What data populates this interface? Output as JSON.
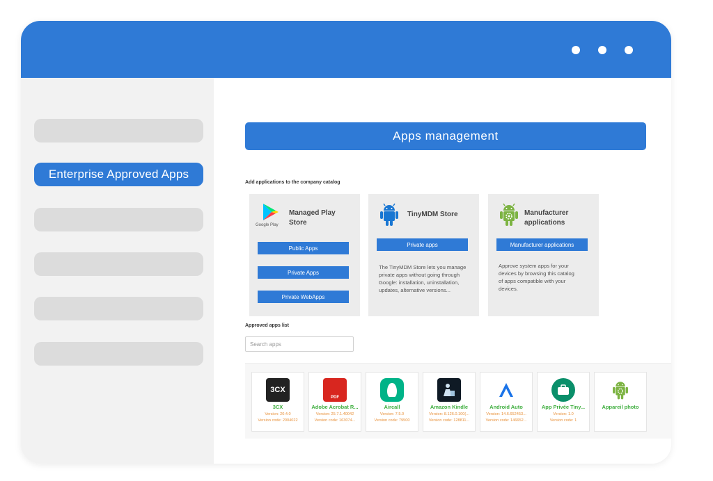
{
  "sidebar": {
    "items": [
      {
        "label": "",
        "active": false
      },
      {
        "label": "Enterprise Approved Apps",
        "active": true
      },
      {
        "label": "",
        "active": false
      },
      {
        "label": "",
        "active": false
      },
      {
        "label": "",
        "active": false
      },
      {
        "label": "",
        "active": false
      }
    ]
  },
  "main": {
    "header": "Apps management",
    "catalog_label": "Add applications to the company catalog",
    "cards": {
      "play": {
        "title": "Managed Play Store",
        "logo_caption": "Google Play",
        "buttons": [
          "Public Apps",
          "Private Apps",
          "Private WebApps"
        ]
      },
      "tinymdm": {
        "title": "TinyMDM Store",
        "button": "Private apps",
        "description": "The TinyMDM Store lets you manage private apps without going through Google: installation, uninstallation, updates, alternative versions..."
      },
      "manufacturer": {
        "title": "Manufacturer applications",
        "button": "Manufacturer applications",
        "description": "Approve system apps for your devices by browsing this catalog of apps compatible with your devices."
      }
    },
    "approved_label": "Approved apps list",
    "search": {
      "placeholder": "Search apps"
    }
  },
  "apps": [
    {
      "name": "3CX",
      "version": "Version: 20.4.0",
      "code": "Version code: 2004022",
      "icon": "3cx-icon",
      "icon_text": "3CX"
    },
    {
      "name": "Adobe Acrobat R...",
      "version": "Version: 25.7.1.40042",
      "code": "Version code: 163074...",
      "icon": "acrobat-icon",
      "icon_text": "PDF"
    },
    {
      "name": "Aircall",
      "version": "Version: 7.5.0",
      "code": "Version code: 79500",
      "icon": "aircall-icon",
      "icon_text": ""
    },
    {
      "name": "Amazon Kindle",
      "version": "Version: 8.126.0.100(...",
      "code": "Version code: 128811...",
      "icon": "kindle-icon",
      "icon_text": ""
    },
    {
      "name": "Android Auto",
      "version": "Version: 14.6.652453...",
      "code": "Version code: 146652...",
      "icon": "android-auto-icon",
      "icon_text": ""
    },
    {
      "name": "App Privée Tiny...",
      "version": "Version: 1.0",
      "code": "Version code: 1",
      "icon": "briefcase-icon",
      "icon_text": ""
    },
    {
      "name": "Appareil photo",
      "version": "",
      "code": "",
      "icon": "android-gear-icon",
      "icon_text": ""
    }
  ],
  "colors": {
    "accent": "#2f7ad6",
    "android_green": "#7cb342",
    "app_name": "#3fae3f",
    "version_text": "#e8913a"
  }
}
